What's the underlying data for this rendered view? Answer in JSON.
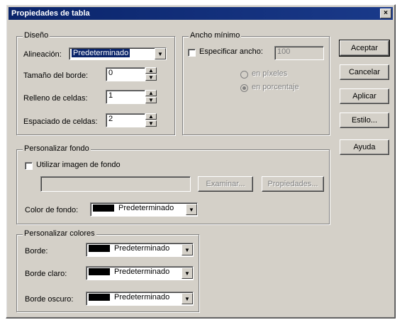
{
  "dialog": {
    "title": "Propiedades de tabla",
    "close_glyph": "×"
  },
  "diseno": {
    "legend": "Diseño",
    "alineacion_label": "Alineación:",
    "alineacion_value": "Predeterminado",
    "tamano_borde_label": "Tamaño del borde:",
    "tamano_borde_value": "0",
    "relleno_label": "Relleno de celdas:",
    "relleno_value": "1",
    "espaciado_label": "Espaciado de celdas:",
    "espaciado_value": "2"
  },
  "ancho": {
    "legend": "Ancho mínimo",
    "especificar_label": "Especificar ancho:",
    "ancho_value": "100",
    "pixeles_label": "en píxeles",
    "porcentaje_label": "en porcentaje"
  },
  "fondo": {
    "legend": "Personalizar fondo",
    "utilizar_label": "Utilizar imagen de fondo",
    "image_path": "",
    "examinar_label": "Examinar...",
    "propiedades_label": "Propiedades...",
    "color_label": "Color de fondo:",
    "color_value": "Predeterminado"
  },
  "colores": {
    "legend": "Personalizar colores",
    "borde_label": "Borde:",
    "borde_value": "Predeterminado",
    "borde_claro_label": "Borde claro:",
    "borde_claro_value": "Predeterminado",
    "borde_oscuro_label": "Borde oscuro:",
    "borde_oscuro_value": "Predeterminado"
  },
  "buttons": {
    "aceptar": "Aceptar",
    "cancelar": "Cancelar",
    "aplicar": "Aplicar",
    "estilo": "Estilo...",
    "ayuda": "Ayuda"
  },
  "glyphs": {
    "dropdown": "▼",
    "spin_up": "▲",
    "spin_down": "▼",
    "check": ""
  },
  "colors": {
    "title_bar": "#0a246a",
    "face": "#d4d0c8",
    "swatch": "#000000"
  }
}
